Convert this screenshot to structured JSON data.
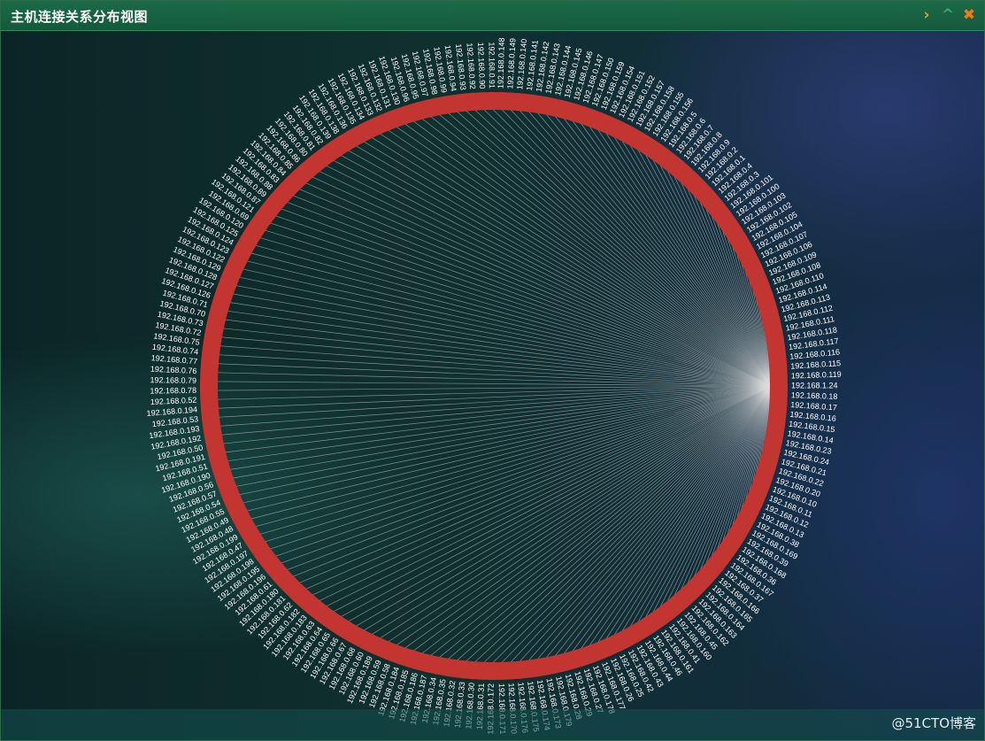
{
  "window": {
    "title": "主机连接关系分布视图",
    "buttons": {
      "next": "›",
      "collapse": "^",
      "close": "✖"
    }
  },
  "watermark": "@51CTO博客",
  "colors": {
    "ring": "#c23531",
    "links": "#dddddd",
    "labels": "#ffffff",
    "titlebar": "#166044"
  },
  "chart_data": {
    "type": "chord",
    "hub": "192.168.1.24",
    "nodes": [
      "192.168.0.91",
      "192.168.0.148",
      "192.168.0.149",
      "192.168.0.140",
      "192.168.0.141",
      "192.168.0.142",
      "192.168.0.143",
      "192.168.0.144",
      "192.168.0.145",
      "192.168.0.146",
      "192.168.0.147",
      "192.168.0.150",
      "192.168.0.159",
      "192.168.0.154",
      "192.168.0.151",
      "192.168.0.152",
      "192.168.0.157",
      "192.168.0.158",
      "192.168.0.155",
      "192.168.0.156",
      "192.168.0.5",
      "192.168.0.6",
      "192.168.0.7",
      "192.168.0.8",
      "192.168.0.9",
      "192.168.0.2",
      "192.168.0.1",
      "192.168.0.4",
      "192.168.0.3",
      "192.168.0.101",
      "192.168.0.100",
      "192.168.0.103",
      "192.168.0.102",
      "192.168.0.105",
      "192.168.0.104",
      "192.168.0.107",
      "192.168.0.106",
      "192.168.0.109",
      "192.168.0.108",
      "192.168.0.110",
      "192.168.0.114",
      "192.168.0.113",
      "192.168.0.112",
      "192.168.0.111",
      "192.168.0.118",
      "192.168.0.117",
      "192.168.0.116",
      "192.168.0.115",
      "192.168.0.119",
      "192.168.1.24",
      "192.168.0.18",
      "192.168.0.17",
      "192.168.0.16",
      "192.168.0.15",
      "192.168.0.14",
      "192.168.0.23",
      "192.168.0.24",
      "192.168.0.21",
      "192.168.0.22",
      "192.168.0.20",
      "192.168.0.10",
      "192.168.0.11",
      "192.168.0.12",
      "192.168.0.13",
      "192.168.0.38",
      "192.168.0.169",
      "192.168.0.39",
      "192.168.0.168",
      "192.168.0.36",
      "192.168.0.167",
      "192.168.0.37",
      "192.168.0.166",
      "192.168.0.165",
      "192.168.0.164",
      "192.168.0.163",
      "192.168.0.162",
      "192.168.0.45",
      "192.168.0.160",
      "192.168.0.41",
      "192.168.0.161",
      "192.168.0.46",
      "192.168.0.44",
      "192.168.0.43",
      "192.168.0.42",
      "192.168.0.25",
      "192.168.0.26",
      "192.168.0.177",
      "192.168.0.178",
      "192.168.0.27",
      "192.168.0.29",
      "192.168.0.28",
      "192.168.0.179",
      "192.168.0.173",
      "192.168.0.174",
      "192.168.0.175",
      "192.168.0.176",
      "192.168.0.170",
      "192.168.0.171",
      "192.168.0.172",
      "192.168.0.31",
      "192.168.0.30",
      "192.168.0.33",
      "192.168.0.32",
      "192.168.0.35",
      "192.168.0.34",
      "192.168.0.187",
      "192.168.0.186",
      "192.168.0.185",
      "192.168.0.184",
      "192.168.0.58",
      "192.168.0.59",
      "192.168.0.189",
      "192.168.0.60",
      "192.168.0.68",
      "192.168.0.67",
      "192.168.0.66",
      "192.168.0.65",
      "192.168.0.64",
      "192.168.0.63",
      "192.168.0.183",
      "192.168.0.182",
      "192.168.0.62",
      "192.168.0.181",
      "192.168.0.180",
      "192.168.0.61",
      "192.168.0.196",
      "192.168.0.195",
      "192.168.0.198",
      "192.168.0.197",
      "192.168.0.47",
      "192.168.0.199",
      "192.168.0.48",
      "192.168.0.49",
      "192.168.0.55",
      "192.168.0.54",
      "192.168.0.57",
      "192.168.0.56",
      "192.168.0.190",
      "192.168.0.51",
      "192.168.0.191",
      "192.168.0.50",
      "192.168.0.192",
      "192.168.0.193",
      "192.168.0.53",
      "192.168.0.194",
      "192.168.0.52",
      "192.168.0.78",
      "192.168.0.79",
      "192.168.0.76",
      "192.168.0.77",
      "192.168.0.74",
      "192.168.0.75",
      "192.168.0.72",
      "192.168.0.73",
      "192.168.0.70",
      "192.168.0.71",
      "192.168.0.126",
      "192.168.0.127",
      "192.168.0.128",
      "192.168.0.129",
      "192.168.0.122",
      "192.168.0.123",
      "192.168.0.124",
      "192.168.0.125",
      "192.168.0.120",
      "192.168.0.69",
      "192.168.0.121",
      "192.168.0.87",
      "192.168.0.89",
      "192.168.0.88",
      "192.168.0.83",
      "192.168.0.84",
      "192.168.0.85",
      "192.168.0.86",
      "192.168.0.80",
      "192.168.0.81",
      "192.168.0.82",
      "192.168.0.139",
      "192.168.0.138",
      "192.168.0.136",
      "192.168.0.135",
      "192.168.0.134",
      "192.168.0.133",
      "192.168.0.132",
      "192.168.0.131",
      "192.168.0.130",
      "192.168.0.96",
      "192.168.0.95",
      "192.168.0.97",
      "192.168.0.98",
      "192.168.0.99",
      "192.168.0.94",
      "192.168.0.93",
      "192.168.0.92",
      "192.168.0.90"
    ]
  }
}
